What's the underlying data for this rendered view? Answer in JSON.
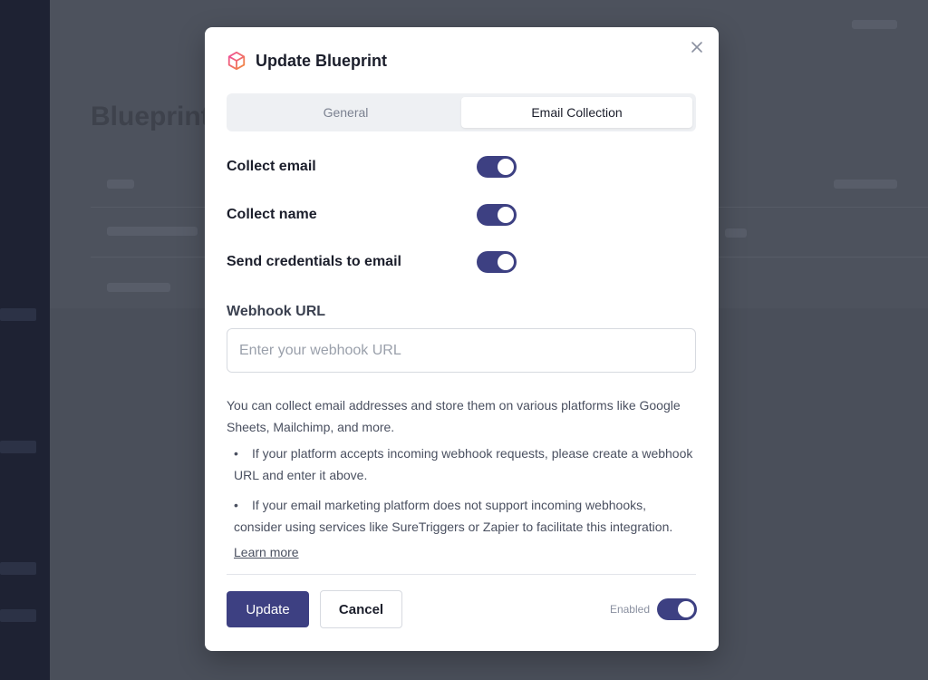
{
  "background": {
    "page_title": "Blueprint"
  },
  "modal": {
    "title": "Update Blueprint",
    "icon": "cube-icon",
    "close_icon": "close-icon",
    "tabs": [
      {
        "label": "General",
        "active": false
      },
      {
        "label": "Email Collection",
        "active": true
      }
    ],
    "settings": [
      {
        "label": "Collect email",
        "enabled": true
      },
      {
        "label": "Collect name",
        "enabled": true
      },
      {
        "label": "Send credentials to email",
        "enabled": true
      }
    ],
    "webhook": {
      "label": "Webhook URL",
      "value": "",
      "placeholder": "Enter your webhook URL"
    },
    "description": "You can collect email addresses and store them on various platforms like Google Sheets, Mailchimp, and more.",
    "bullets": [
      "If your platform accepts incoming webhook requests, please create a webhook URL and enter it above.",
      "If your email marketing platform does not support incoming webhooks, consider using services like SureTriggers or Zapier to facilitate this integration."
    ],
    "learn_more": "Learn more",
    "footer": {
      "update_label": "Update",
      "cancel_label": "Cancel",
      "enabled_label": "Enabled",
      "enabled": true
    }
  },
  "colors": {
    "accent": "#3d4082",
    "overlay": "#4b505c",
    "sidebar": "#1e2233"
  }
}
